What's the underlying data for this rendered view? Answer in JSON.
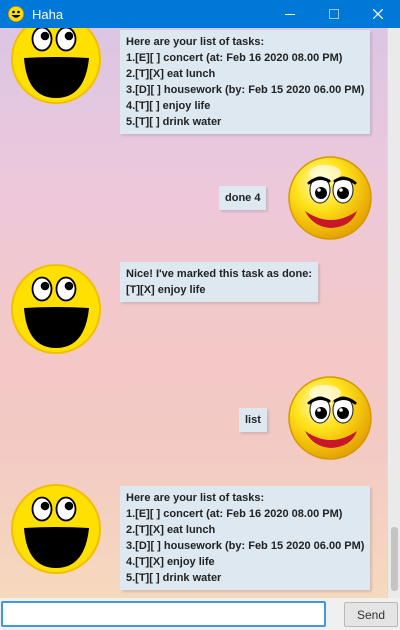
{
  "window": {
    "title": "Haha",
    "icon": "smiley-icon",
    "controls": [
      "minimize-icon",
      "maximize-icon",
      "close-icon"
    ]
  },
  "messages": [
    {
      "sender": "bot",
      "avatar": "grinning-smiley-avatar",
      "lines": [
        "Here are your list of tasks:",
        "1.[E][ ] concert (at: Feb 16 2020 08.00 PM)",
        "2.[T][X] eat lunch",
        "3.[D][ ] housework (by: Feb 15 2020 06.00 PM)",
        "4.[T][ ] enjoy life",
        "5.[T][ ] drink water"
      ]
    },
    {
      "sender": "user",
      "avatar": "glossy-smiley-avatar",
      "lines": [
        "done 4"
      ]
    },
    {
      "sender": "bot",
      "avatar": "grinning-smiley-avatar",
      "lines": [
        "Nice! I've marked this task as done:",
        "[T][X] enjoy life"
      ]
    },
    {
      "sender": "user",
      "avatar": "glossy-smiley-avatar",
      "lines": [
        "list"
      ]
    },
    {
      "sender": "bot",
      "avatar": "grinning-smiley-avatar",
      "lines": [
        "Here are your list of tasks:",
        "1.[E][ ] concert (at: Feb 16 2020 08.00 PM)",
        "2.[T][X] eat lunch",
        "3.[D][ ] housework (by: Feb 15 2020 06.00 PM)",
        "4.[T][X] enjoy life",
        "5.[T][ ] drink water"
      ]
    }
  ],
  "input": {
    "value": "",
    "placeholder": ""
  },
  "send_button": {
    "label": "Send"
  },
  "colors": {
    "titlebar": "#0078d7",
    "bubble": "#dde8f1",
    "input_focus_border": "#3f98e0",
    "smiley_yellow": "#ffe000"
  }
}
